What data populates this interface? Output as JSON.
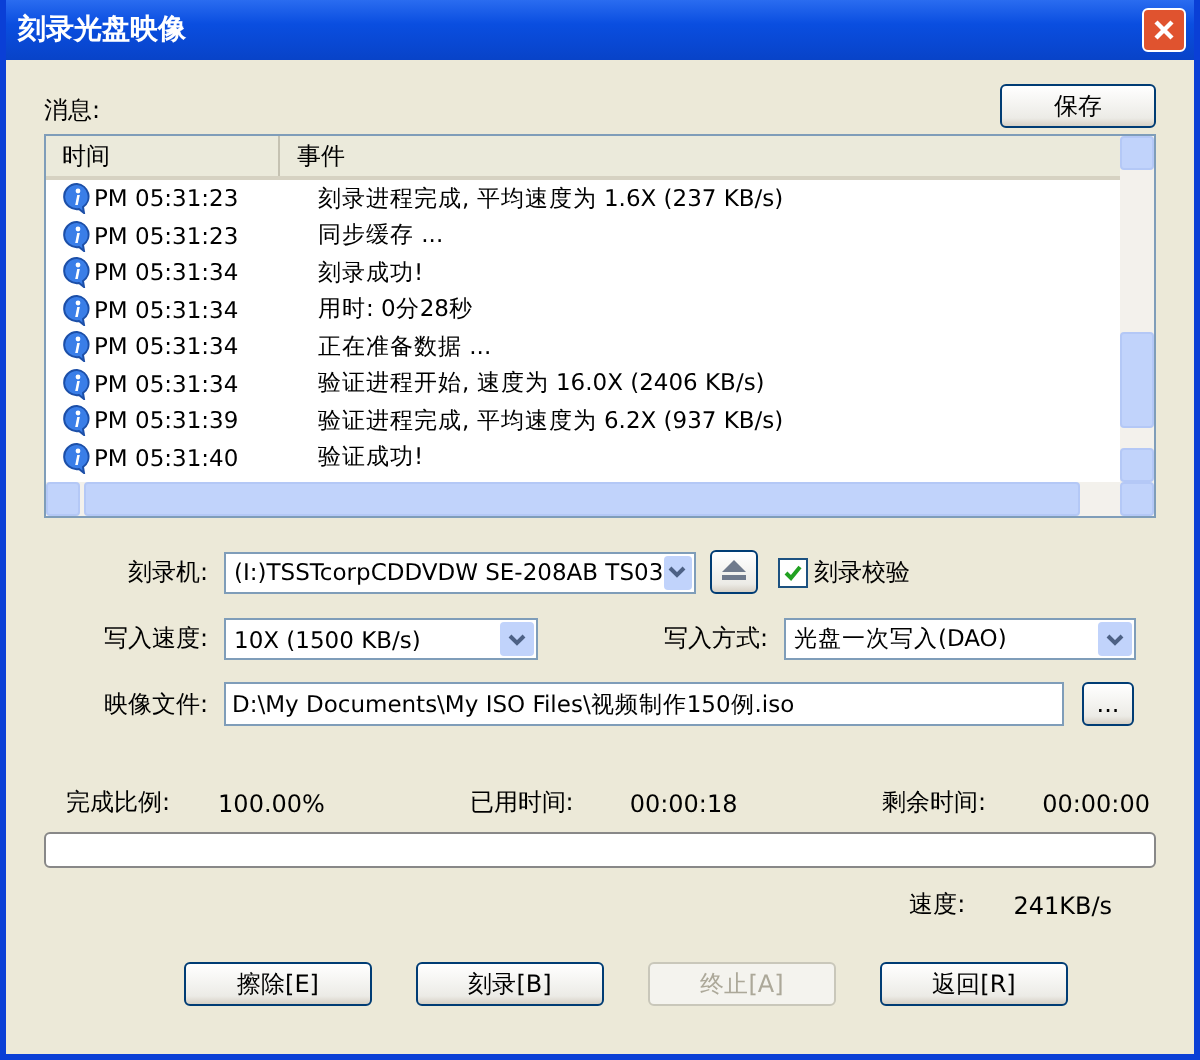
{
  "window": {
    "title": "刻录光盘映像"
  },
  "messages": {
    "label": "消息:",
    "save_button": "保存",
    "columns": [
      "时间",
      "事件"
    ],
    "rows": [
      {
        "time": "PM 05:31:23",
        "event": "刻录进程完成, 平均速度为 1.6X (237 KB/s)"
      },
      {
        "time": "PM 05:31:23",
        "event": "同步缓存 ..."
      },
      {
        "time": "PM 05:31:34",
        "event": "刻录成功!"
      },
      {
        "time": "PM 05:31:34",
        "event": "用时: 0分28秒"
      },
      {
        "time": "PM 05:31:34",
        "event": "正在准备数据 ..."
      },
      {
        "time": "PM 05:31:34",
        "event": "验证进程开始, 速度为 16.0X (2406 KB/s)"
      },
      {
        "time": "PM 05:31:39",
        "event": "验证进程完成, 平均速度为 6.2X (937 KB/s)"
      },
      {
        "time": "PM 05:31:40",
        "event": "验证成功!"
      }
    ]
  },
  "recorder": {
    "label": "刻录机:",
    "value": "(I:)TSSTcorpCDDVDW SE-208AB TS03"
  },
  "verify": {
    "label": "刻录校验",
    "checked": true
  },
  "write_speed": {
    "label": "写入速度:",
    "value": "10X (1500 KB/s)"
  },
  "write_mode": {
    "label": "写入方式:",
    "value": "光盘一次写入(DAO)"
  },
  "image_file": {
    "label": "映像文件:",
    "value": "D:\\My Documents\\My ISO Files\\视频制作150例.iso",
    "browse": "..."
  },
  "stats": [
    {
      "label": "完成比例:",
      "value": "100.00%"
    },
    {
      "label": "已用时间:",
      "value": "00:00:18"
    },
    {
      "label": "剩余时间:",
      "value": "00:00:00"
    }
  ],
  "progress": {
    "level": 0
  },
  "speed": {
    "label": "速度:",
    "value": "241KB/s"
  },
  "buttons": [
    {
      "label": "擦除[E]",
      "disabled": false
    },
    {
      "label": "刻录[B]",
      "disabled": false
    },
    {
      "label": "终止[A]",
      "disabled": true
    },
    {
      "label": "返回[R]",
      "disabled": false
    }
  ]
}
